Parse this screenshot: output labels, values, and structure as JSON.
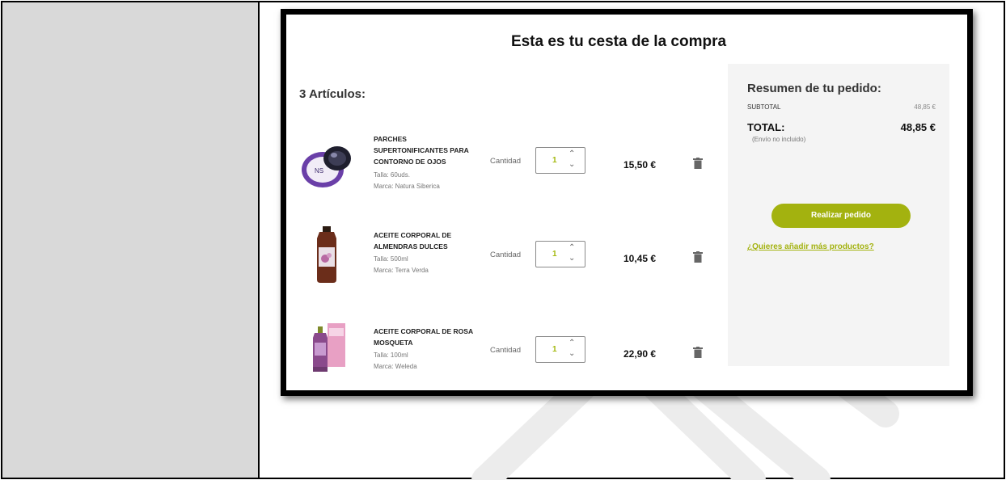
{
  "cart": {
    "title": "Esta es tu cesta de la compra",
    "items_count_label": "3 Artículos:",
    "quantity_label": "Cantidad",
    "items": [
      {
        "name": "PARCHES SUPERTONIFICANTES PARA CONTORNO DE OJOS",
        "size": "Talla: 60uds.",
        "brand": "Marca: Natura Siberica",
        "quantity": "1",
        "price": "15,50 €",
        "thumb_icon": "eye-patches-jar-image"
      },
      {
        "name": "ACEITE CORPORAL DE ALMENDRAS DULCES",
        "size": "Talla: 500ml",
        "brand": "Marca: Terra Verda",
        "quantity": "1",
        "price": "10,45 €",
        "thumb_icon": "oil-bottle-image"
      },
      {
        "name": "ACEITE CORPORAL DE ROSA MOSQUETA",
        "size": "Talla: 100ml",
        "brand": "Marca: Weleda",
        "quantity": "1",
        "price": "22,90 €",
        "thumb_icon": "rose-oil-box-image"
      }
    ]
  },
  "summary": {
    "title": "Resumen de tu pedido:",
    "subtotal_label": "SUBTOTAL",
    "subtotal_value": "48,85 €",
    "total_label": "TOTAL:",
    "total_value": "48,85 €",
    "shipping_note": "(Envío no incluido)",
    "order_button": "Realizar pedido",
    "more_products_link": "¿Quieres añadir más productos?"
  },
  "colors": {
    "accent": "#a3b20f",
    "left_panel": "#d9d9d9",
    "summary_bg": "#f4f4f4"
  }
}
